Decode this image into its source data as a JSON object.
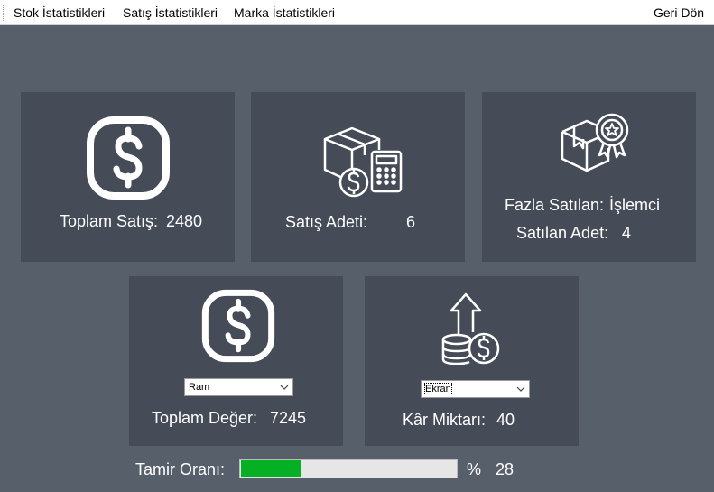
{
  "menu": {
    "items": [
      "Stok İstatistikleri",
      "Satış İstatistikleri",
      "Marka İstatistikleri"
    ],
    "back_label": "Geri Dön"
  },
  "cards": {
    "total_sales": {
      "label": "Toplam Satış:",
      "value": "2480",
      "icon": "dollar-icon"
    },
    "sales_count": {
      "label": "Satış Adeti:",
      "value": "6",
      "icon": "box-calculator-icon"
    },
    "best_seller": {
      "label": "Fazla Satılan:",
      "value": "İşlemci",
      "count_label": "Satılan Adet:",
      "count_value": "4",
      "icon": "award-box-icon"
    },
    "total_value": {
      "label": "Toplam Değer:",
      "value": "7245",
      "select_value": "Ram",
      "icon": "dollar-icon"
    },
    "profit": {
      "label": "Kâr Miktarı:",
      "value": "40",
      "select_value": "Ekran",
      "icon": "coins-up-icon"
    }
  },
  "repair": {
    "label": "Tamir Oranı:",
    "percent_sign": "%",
    "value": "28",
    "fraction": 0.28,
    "fill_color": "#06b025"
  }
}
